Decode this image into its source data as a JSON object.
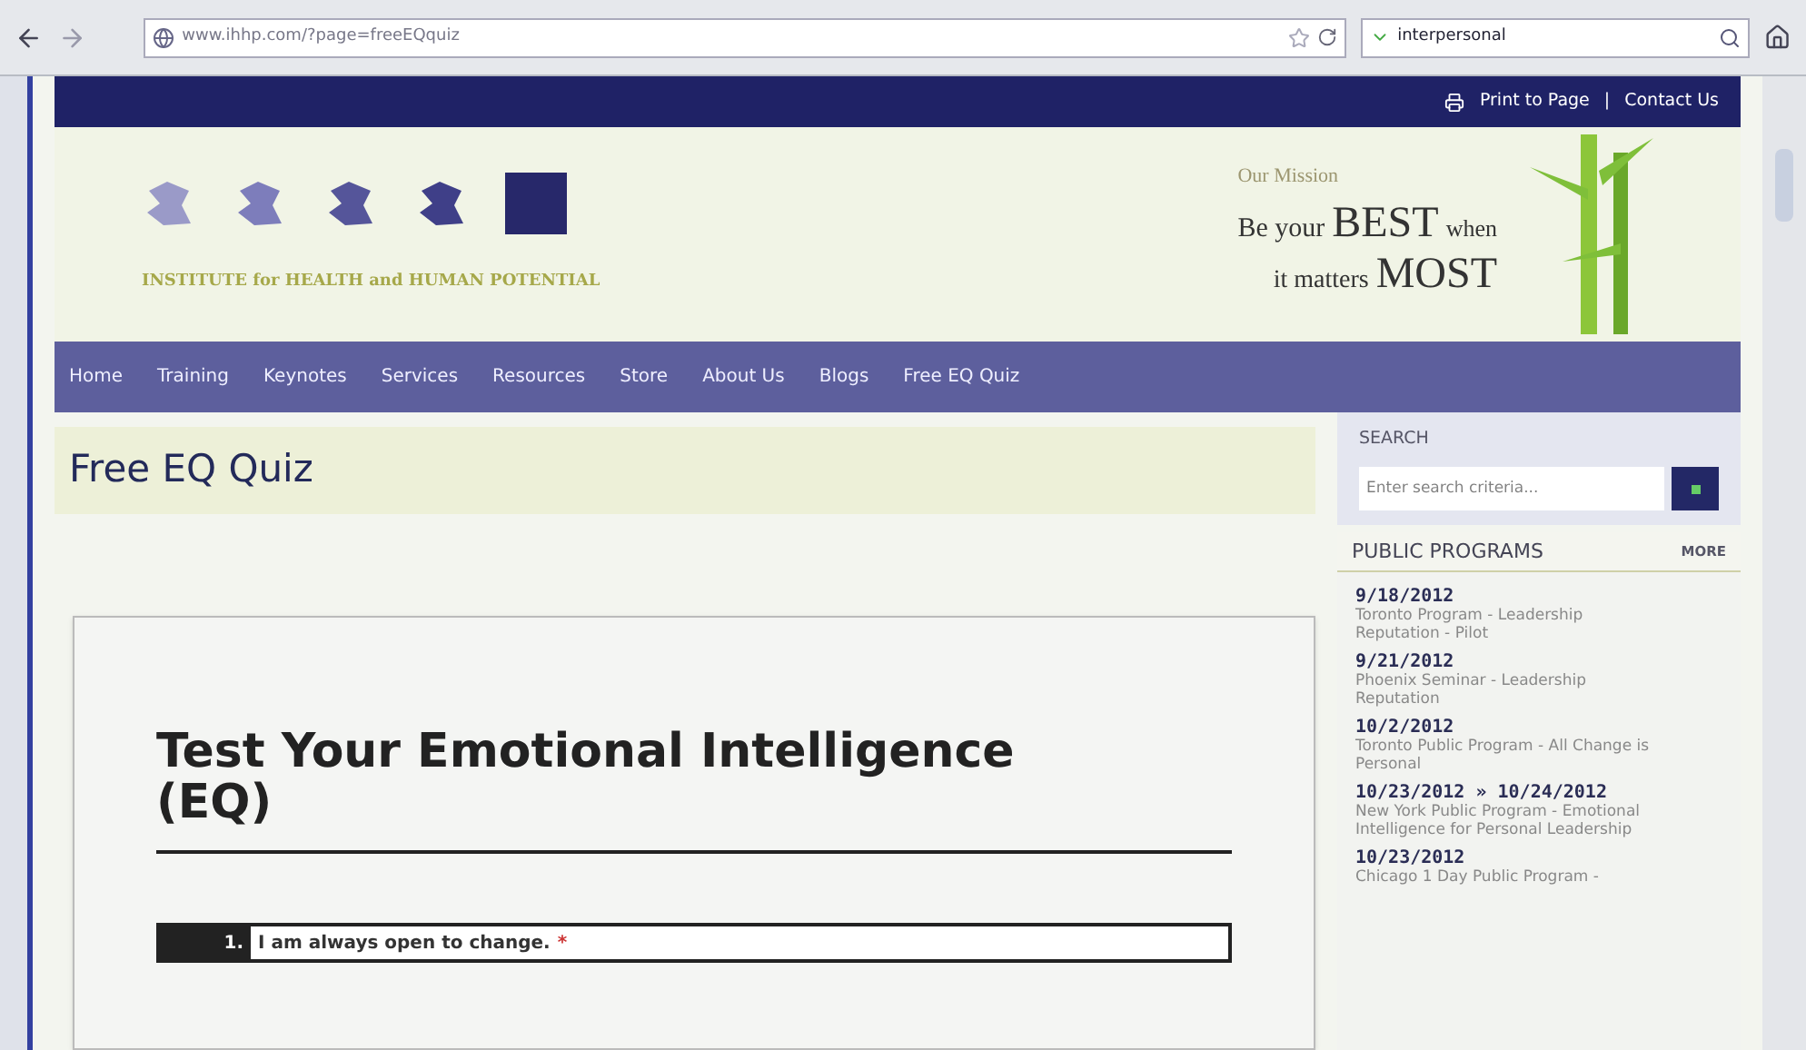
{
  "browser": {
    "url": "www.ihhp.com/?page=freeEQquiz",
    "search_value": "interpersonal"
  },
  "top_bar": {
    "links": [
      "Print to Page",
      "|",
      "Contact Us"
    ]
  },
  "header": {
    "institute": "INSTITUTE for HEALTH and HUMAN POTENTIAL",
    "mission_label": "Our Mission",
    "tagline": [
      "Be your",
      "BEST",
      "when",
      "it matters",
      "MOST"
    ]
  },
  "nav": [
    "Home",
    "Training",
    "Keynotes",
    "Services",
    "Resources",
    "Store",
    "About Us",
    "Blogs",
    "Free EQ Quiz"
  ],
  "page_title": "Free EQ Quiz",
  "quiz": {
    "title": "Test Your Emotional Intelligence (EQ)",
    "questions": [
      {
        "number": "1.",
        "text": "I am always open to change.",
        "required_mark": "*"
      }
    ]
  },
  "sidebar": {
    "search_title": "SEARCH",
    "search_placeholder": "Enter search criteria...",
    "programs_title": "PUBLIC PROGRAMS",
    "more": "MORE",
    "programs": [
      {
        "date": "9/18/2012",
        "name": "Toronto Program - Leadership Reputation - Pilot"
      },
      {
        "date": "9/21/2012",
        "name": "Phoenix Seminar - Leadership Reputation"
      },
      {
        "date": "10/2/2012",
        "name": "Toronto Public Program - All Change is Personal"
      },
      {
        "date": "10/23/2012 » 10/24/2012",
        "name": "New York Public Program - Emotional Intelligence for Personal Leadership"
      },
      {
        "date": "10/23/2012",
        "name": "Chicago 1 Day Public Program -"
      }
    ]
  }
}
